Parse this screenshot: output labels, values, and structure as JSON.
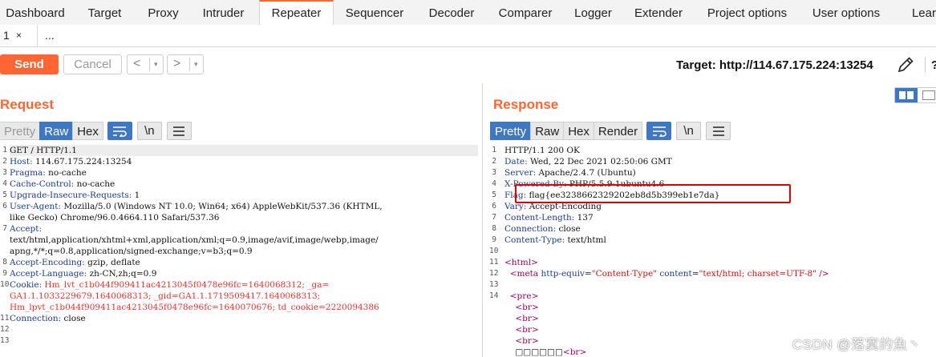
{
  "nav_tabs": [
    "Dashboard",
    "Target",
    "Proxy",
    "Intruder",
    "Repeater",
    "Sequencer",
    "Decoder",
    "Comparer",
    "Logger",
    "Extender",
    "Project options",
    "User options",
    "Lear"
  ],
  "active_nav_tab": "Repeater",
  "sub_tabs": {
    "tab1_number": "1",
    "tab1_close": "×",
    "new_tab": "..."
  },
  "toolbar": {
    "send_label": "Send",
    "cancel_label": "Cancel",
    "back_arrow": "<",
    "forward_arrow": ">",
    "dropdown_caret": "▾",
    "target_text": "Target: http://114.67.175.224:13254",
    "help_label": "?"
  },
  "request": {
    "title": "Request",
    "formats": [
      "Pretty",
      "Raw",
      "Hex"
    ],
    "selected_format": "Raw",
    "newline_toggle": "\\n",
    "line_numbers": [
      "1",
      "2",
      "3",
      "4",
      "5",
      "6",
      "",
      "7",
      "",
      "",
      "8",
      "9",
      "10",
      "",
      "",
      "11",
      "12",
      "13"
    ],
    "lines": [
      {
        "key": "GET / HTTP/1.1",
        "val": ""
      },
      {
        "key": "Host:",
        "val": " 114.67.175.224:13254"
      },
      {
        "key": "Pragma:",
        "val": " no-cache"
      },
      {
        "key": "Cache-Control:",
        "val": " no-cache"
      },
      {
        "key": "Upgrade-Insecure-Requests:",
        "val": " 1"
      },
      {
        "key": "User-Agent:",
        "val": " Mozilla/5.0 (Windows NT 10.0; Win64; x64) AppleWebKit/537.36 (KHTML,"
      },
      {
        "key": "",
        "val": "like Gecko) Chrome/96.0.4664.110 Safari/537.36"
      },
      {
        "key": "Accept:",
        "val": ""
      },
      {
        "key": "",
        "val": "text/html,application/xhtml+xml,application/xml;q=0.9,image/avif,image/webp,image/"
      },
      {
        "key": "",
        "val": "apng,*/*;q=0.8,application/signed-exchange;v=b3;q=0.9"
      },
      {
        "key": "Accept-Encoding:",
        "val": " gzip, deflate"
      },
      {
        "key": "Accept-Language:",
        "val": " zh-CN,zh;q=0.9"
      },
      {
        "key": "Cookie:",
        "val": " Hm_lvt_c1b044f909411ac4213045f0478e96fc=1640068312; _ga="
      },
      {
        "key": "",
        "val": "GA1.1.1033229679.1640068313; _gid=GA1.1.1719509417.1640068313;"
      },
      {
        "key": "",
        "val": "Hm_lpvt_c1b044f909411ac4213045f0478e96fc=1640070676; td_cookie=2220094386"
      },
      {
        "key": "Connection:",
        "val": " close"
      },
      {
        "key": "",
        "val": ""
      },
      {
        "key": "",
        "val": ""
      }
    ]
  },
  "response": {
    "title": "Response",
    "formats": [
      "Pretty",
      "Raw",
      "Hex",
      "Render"
    ],
    "selected_format": "Pretty",
    "newline_toggle": "\\n",
    "line_numbers": [
      "1",
      "2",
      "3",
      "4",
      "5",
      "6",
      "7",
      "8",
      "9",
      "10",
      "11",
      "12",
      "13",
      "14",
      "",
      "",
      "",
      "",
      ""
    ],
    "lines": [
      {
        "key": "HTTP/1.1 200 OK",
        "val": ""
      },
      {
        "key": "Date:",
        "val": " Wed, 22 Dec 2021 02:50:06 GMT"
      },
      {
        "key": "Server:",
        "val": " Apache/2.4.7 (Ubuntu)"
      },
      {
        "key": "X-Powered-By:",
        "val": " PHP/5.5.9-1ubuntu4.6"
      },
      {
        "key": "Flag:",
        "val": " flag{ee3238662329202eb8d5b399eb1e7da}"
      },
      {
        "key": "Vary:",
        "val": " Accept-Encoding"
      },
      {
        "key": "Content-Length:",
        "val": " 137"
      },
      {
        "key": "Connection:",
        "val": " close"
      },
      {
        "key": "Content-Type:",
        "val": " text/html"
      },
      {
        "key": "",
        "val": ""
      }
    ],
    "html_lines": {
      "html_open": "<html>",
      "meta_tag_open": "<meta",
      "meta_attr1": " http-equiv",
      "meta_eq1": "=",
      "meta_val1": "\"Content-Type\"",
      "meta_attr2": " content",
      "meta_eq2": "=",
      "meta_val2": "\"text/html; charset=UTF-8\"",
      "meta_close": " />",
      "pre_open": "<pre>",
      "br": "<br>",
      "last_line_text": "□□□□□□",
      "last_line_br": "<br>"
    }
  },
  "watermark": "CSDN @落寞的魚丶"
}
